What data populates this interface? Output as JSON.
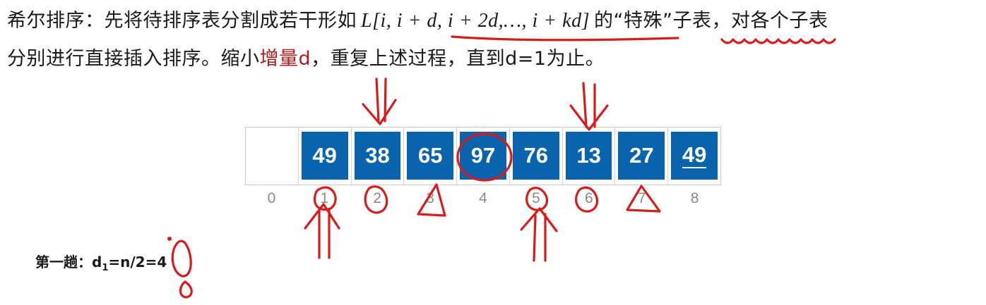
{
  "text": {
    "line1_a": "希尔排序：先将待排序表分割成若干形如",
    "formula": "L[i, i + d, i + 2d,…, i + kd]",
    "line1_b": "的“特殊”子表，对各个子表",
    "line2_a": "分别进行直接插入排序。缩小",
    "line2_hl": "增量d",
    "line2_b": "，重复上述过程，直到d=1为止。"
  },
  "array": {
    "cells": [
      {
        "index": "0",
        "value": ""
      },
      {
        "index": "1",
        "value": "49"
      },
      {
        "index": "2",
        "value": "38"
      },
      {
        "index": "3",
        "value": "65"
      },
      {
        "index": "4",
        "value": "97"
      },
      {
        "index": "5",
        "value": "76"
      },
      {
        "index": "6",
        "value": "13"
      },
      {
        "index": "7",
        "value": "27"
      },
      {
        "index": "8",
        "value": "49"
      }
    ]
  },
  "pass": {
    "label": "第一趟：",
    "d_symbol": "d",
    "d_sub": "1",
    "expr": "=n/2=4"
  },
  "colors": {
    "box_fill": "#0a63ad",
    "highlight_text": "#b31b1b",
    "ink_red": "#d81b1b"
  },
  "icons": {
    "cursor": "mouse-pointer-icon"
  }
}
